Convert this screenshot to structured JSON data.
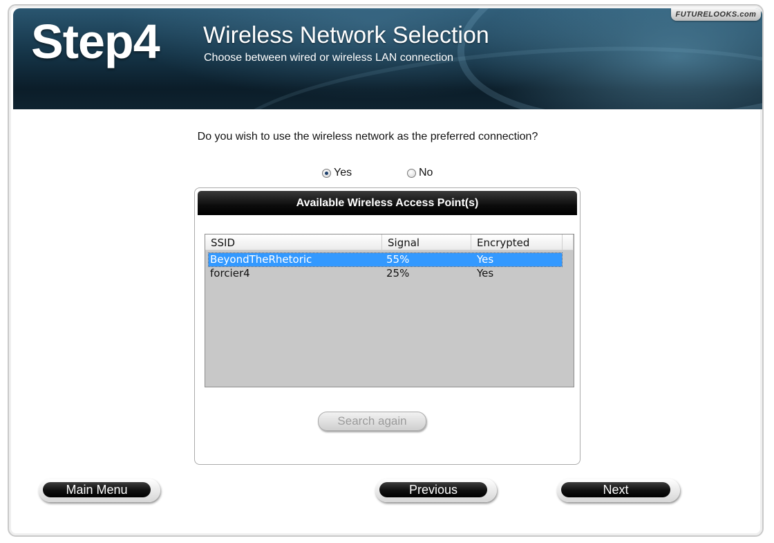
{
  "header": {
    "step": "Step4",
    "title": "Wireless Network Selection",
    "subtitle": "Choose between wired or wireless LAN connection",
    "watermark": "FUTURELOOKS.com"
  },
  "question": "Do you wish to use the wireless network as the preferred connection?",
  "options": {
    "yes": "Yes",
    "no": "No",
    "selected": "Yes"
  },
  "access_points": {
    "title": "Available Wireless Access Point(s)",
    "columns": [
      "SSID",
      "Signal",
      "Encrypted"
    ],
    "rows": [
      {
        "ssid": "BeyondTheRhetoric",
        "signal": "55%",
        "encrypted": "Yes",
        "selected": true
      },
      {
        "ssid": "forcier4",
        "signal": "25%",
        "encrypted": "Yes",
        "selected": false
      }
    ],
    "search_label": "Search again"
  },
  "nav": {
    "main_menu": "Main Menu",
    "previous": "Previous",
    "next": "Next"
  },
  "colors": {
    "selection": "#3399ff",
    "banner": "#153447"
  }
}
